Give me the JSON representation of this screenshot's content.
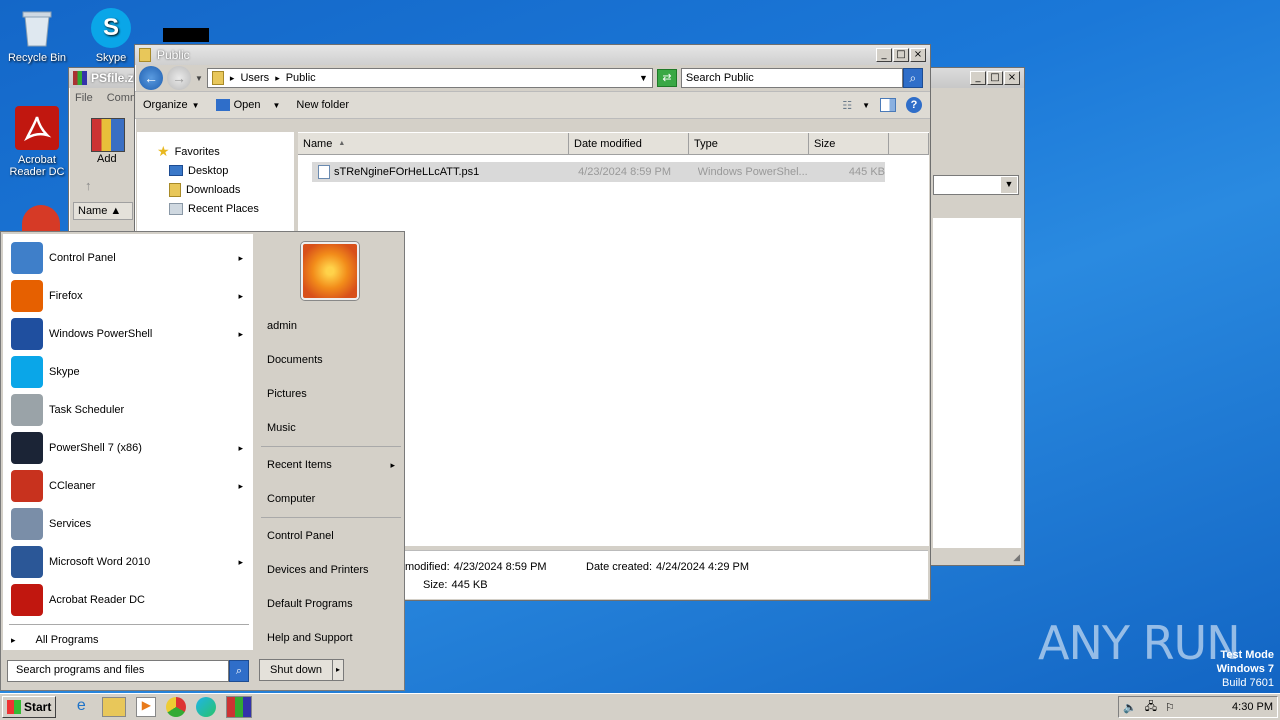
{
  "desktop": {
    "icons": [
      {
        "label": "Recycle Bin"
      },
      {
        "label": "Skype"
      },
      {
        "label": "Acrobat Reader DC"
      }
    ],
    "watermark": {
      "brand": "ANY RUN",
      "line1": "Test Mode",
      "line2": "Windows 7",
      "line3": "Build 7601"
    }
  },
  "back_window": {
    "title": "PSfile.zi",
    "menu": [
      "File",
      "Comm"
    ],
    "add_label": "Add",
    "name_col": "Name"
  },
  "explorer": {
    "title": "Public",
    "breadcrumb": [
      "Users",
      "Public"
    ],
    "search_placeholder": "Search Public",
    "toolbar": {
      "organize": "Organize",
      "open": "Open",
      "new_folder": "New folder"
    },
    "nav": {
      "favorites": "Favorites",
      "items": [
        "Desktop",
        "Downloads",
        "Recent Places"
      ]
    },
    "columns": [
      "Name",
      "Date modified",
      "Type",
      "Size"
    ],
    "files": [
      {
        "name": "sTReNgineFOrHeLLcATT.ps1",
        "modified": "4/23/2024 8:59 PM",
        "type": "Windows PowerShel...",
        "size": "445 KB"
      }
    ],
    "details": {
      "modified_label": "modified:",
      "modified_value": "4/23/2024 8:59 PM",
      "created_label": "Date created:",
      "created_value": "4/24/2024 4:29 PM",
      "size_label": "Size:",
      "size_value": "445 KB"
    }
  },
  "start_menu": {
    "programs": [
      {
        "label": "Control Panel",
        "arrow": true,
        "color": "#3f7fc9"
      },
      {
        "label": "Firefox",
        "arrow": true,
        "color": "#e66000"
      },
      {
        "label": "Windows PowerShell",
        "arrow": true,
        "color": "#1f4f9f"
      },
      {
        "label": "Skype",
        "arrow": false,
        "color": "#0aa6e8"
      },
      {
        "label": "Task Scheduler",
        "arrow": false,
        "color": "#9aa3a8"
      },
      {
        "label": "PowerShell 7 (x86)",
        "arrow": true,
        "color": "#1b2436"
      },
      {
        "label": "CCleaner",
        "arrow": true,
        "color": "#c8321e"
      },
      {
        "label": "Services",
        "arrow": false,
        "color": "#7a8ea8"
      },
      {
        "label": "Microsoft Word 2010",
        "arrow": true,
        "color": "#2b5797"
      },
      {
        "label": "Acrobat Reader DC",
        "arrow": false,
        "color": "#c1170f"
      }
    ],
    "all_programs": "All Programs",
    "search_placeholder": "Search programs and files",
    "right_items": {
      "user": "admin",
      "documents": "Documents",
      "pictures": "Pictures",
      "music": "Music",
      "recent": "Recent Items",
      "computer": "Computer",
      "control_panel": "Control Panel",
      "devices": "Devices and Printers",
      "defaults": "Default Programs",
      "help": "Help and Support"
    },
    "shutdown": "Shut down"
  },
  "taskbar": {
    "start_label": "Start",
    "clock": "4:30 PM"
  }
}
